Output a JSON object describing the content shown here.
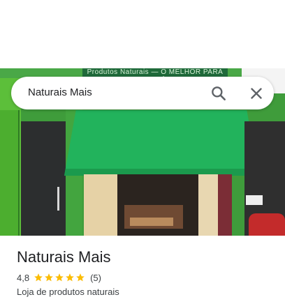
{
  "search": {
    "query": "Naturais Mais"
  },
  "photo": {
    "sign_text": "Produtos Naturais",
    "sign_subtext": "O MELHOR PARA SUA SAÚDE"
  },
  "place": {
    "name": "Naturais Mais",
    "rating": "4,8",
    "review_count": "(5)",
    "category": "Loja de produtos naturais",
    "star_color": "#fbbc04",
    "stars_filled": 5
  },
  "colors": {
    "awning": "#22b35c",
    "wall": "#3f9c3b"
  }
}
